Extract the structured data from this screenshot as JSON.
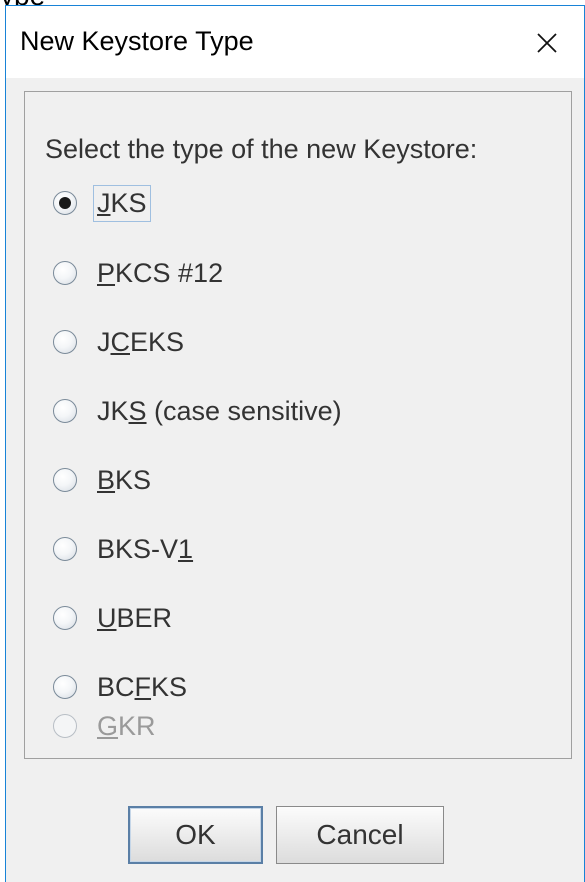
{
  "background_strip_text": "ype",
  "window": {
    "title": "New Keystore Type",
    "close_icon": "close-icon"
  },
  "form": {
    "prompt": "Select the type of the new Keystore:",
    "options": [
      {
        "pre": "",
        "mn": "J",
        "post": "KS",
        "checked": true,
        "disabled": false
      },
      {
        "pre": "",
        "mn": "P",
        "post": "KCS #12",
        "checked": false,
        "disabled": false
      },
      {
        "pre": "J",
        "mn": "C",
        "post": "EKS",
        "checked": false,
        "disabled": false
      },
      {
        "pre": "JK",
        "mn": "S",
        "post": " (case sensitive)",
        "checked": false,
        "disabled": false
      },
      {
        "pre": "",
        "mn": "B",
        "post": "KS",
        "checked": false,
        "disabled": false
      },
      {
        "pre": "BKS-V",
        "mn": "1",
        "post": "",
        "checked": false,
        "disabled": false
      },
      {
        "pre": "",
        "mn": "U",
        "post": "BER",
        "checked": false,
        "disabled": false
      },
      {
        "pre": "BC",
        "mn": "F",
        "post": "KS",
        "checked": false,
        "disabled": false
      },
      {
        "pre": "",
        "mn": "G",
        "post": "KR",
        "checked": false,
        "disabled": true
      }
    ]
  },
  "buttons": {
    "ok": "OK",
    "cancel": "Cancel"
  },
  "colors": {
    "window_border": "#1883d7",
    "dialog_bg": "#f0f0f0",
    "disabled_text": "#9a9a9a"
  }
}
